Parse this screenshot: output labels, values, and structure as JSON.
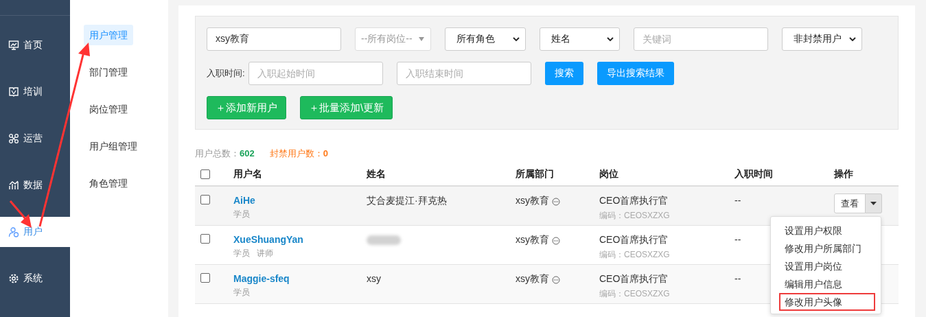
{
  "nav": [
    {
      "label": "首页",
      "selected": false
    },
    {
      "label": "培训",
      "selected": false
    },
    {
      "label": "运营",
      "selected": false
    },
    {
      "label": "数据",
      "selected": false
    },
    {
      "label": "用户",
      "selected": true
    },
    {
      "label": "系统",
      "selected": false
    }
  ],
  "submenu": [
    {
      "label": "用户管理",
      "selected": true
    },
    {
      "label": "部门管理",
      "selected": false
    },
    {
      "label": "岗位管理",
      "selected": false
    },
    {
      "label": "用户组管理",
      "selected": false
    },
    {
      "label": "角色管理",
      "selected": false
    }
  ],
  "filters": {
    "org": {
      "value": "xsy教育"
    },
    "selects": [
      {
        "value": "--所有岗位--",
        "disabled": true
      },
      {
        "value": "所有角色",
        "disabled": false
      },
      {
        "value": "姓名",
        "disabled": false
      }
    ],
    "keyword": {
      "placeholder": "关键词"
    },
    "status_select": {
      "value": "非封禁用户",
      "disabled": false
    },
    "date_label": "入职时间:",
    "date_start": {
      "placeholder": "入职起始时间"
    },
    "date_end": {
      "placeholder": "入职结束时间"
    },
    "search_buttons": [
      "搜索",
      "导出搜索结果"
    ],
    "add_buttons": [
      "＋添加新用户",
      "＋批量添加\\更新"
    ]
  },
  "stats": [
    {
      "label": "用户总数：",
      "value": "602",
      "kind": "total"
    },
    {
      "label": "封禁用户数：",
      "value": "0",
      "kind": "banned"
    }
  ],
  "table": {
    "select_all_checked": false,
    "columns": [
      "用户名",
      "姓名",
      "所属部门",
      "岗位",
      "入职时间",
      "操作"
    ],
    "rows": [
      {
        "checked": false,
        "username": "AiHe",
        "roles": [
          "学员"
        ],
        "name": "艾合麦提江·拜克热",
        "department": "xsy教育",
        "post": "CEO首席执行官",
        "post_code": "编码：CEOSXZXG",
        "hire_date": "--",
        "action": "查看",
        "menu": [
          {
            "label": "设置用户权限",
            "highlighted": false
          },
          {
            "label": "修改用户所属部门",
            "highlighted": false
          },
          {
            "label": "设置用户岗位",
            "highlighted": false
          },
          {
            "label": "编辑用户信息",
            "highlighted": false
          },
          {
            "label": "修改用户头像",
            "highlighted": true
          }
        ]
      },
      {
        "checked": false,
        "username": "XueShuangYan",
        "roles": [
          "学员",
          "讲师"
        ],
        "name_redacted": true,
        "department": "xsy教育",
        "post": "CEO首席执行官",
        "post_code": "编码：CEOSXZXG",
        "hire_date": "--"
      },
      {
        "checked": false,
        "username": "Maggie-sfeq",
        "roles": [
          "学员"
        ],
        "name": "xsy",
        "department": "xsy教育",
        "post": "CEO首席执行官",
        "post_code": "编码：CEOSXZXG",
        "hire_date": "--"
      }
    ]
  },
  "annotation_arrows": true
}
